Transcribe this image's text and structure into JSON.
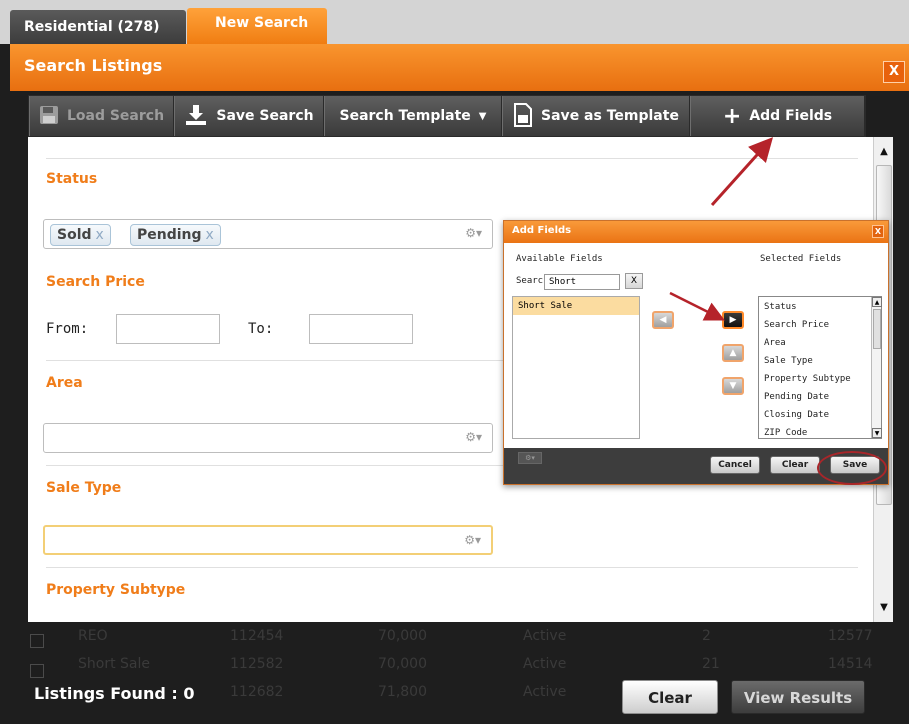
{
  "tabs": {
    "residential": "Residential (278)",
    "new_search": "New Search"
  },
  "modal": {
    "title": "Search Listings",
    "close": "X"
  },
  "toolbar": {
    "load_search": "Load Search",
    "save_search": "Save Search",
    "search_template": "Search Template",
    "save_as_template": "Save as Template",
    "add_fields": "Add Fields"
  },
  "form": {
    "status_label": "Status",
    "status_chips": [
      "Sold",
      "Pending"
    ],
    "chip_remove": "x",
    "search_price_label": "Search Price",
    "from_label": "From:",
    "to_label": "To:",
    "area_label": "Area",
    "sale_type_label": "Sale Type",
    "property_subtype_label": "Property Subtype"
  },
  "dialog": {
    "title": "Add Fields",
    "close": "X",
    "available_label": "Available Fields",
    "selected_label": "Selected Fields",
    "search_label": "Search",
    "search_value": "Short",
    "search_clear": "X",
    "available_items": [
      "Short Sale"
    ],
    "selected_items": [
      "Status",
      "Search Price",
      "Area",
      "Sale Type",
      "Property Subtype",
      "Pending Date",
      "Closing Date",
      "ZIP Code"
    ],
    "cancel": "Cancel",
    "clear": "Clear",
    "save": "Save"
  },
  "background_rows": [
    {
      "type": "REO",
      "id": "112454",
      "price": "70,000",
      "status": "Active",
      "count": "2",
      "num": "12577"
    },
    {
      "type": "Short Sale",
      "id": "112582",
      "price": "70,000",
      "status": "Active",
      "count": "21",
      "num": "14514"
    },
    {
      "type": "",
      "id": "112682",
      "price": "71,800",
      "status": "Active",
      "count": "",
      "num": ""
    }
  ],
  "footer": {
    "listings_found": "Listings Found : 0",
    "clear": "Clear",
    "view_results": "View Results"
  },
  "colors": {
    "accent_orange": "#f07d1a",
    "annotation_red": "#b5232a"
  }
}
